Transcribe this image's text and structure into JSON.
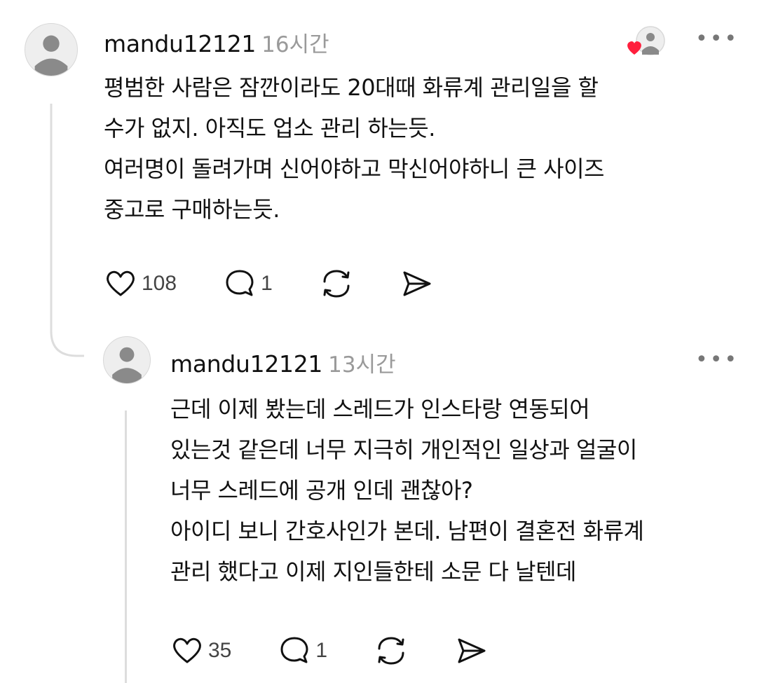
{
  "comments": [
    {
      "username": "mandu12121",
      "time": "16시간",
      "lines": [
        "평범한 사람은 잠깐이라도 20대때 화류계 관리일을 할",
        "수가 없지. 아직도 업소 관리 하는듯.",
        "여러명이 돌려가며 신어야하고 막신어야하니 큰 사이즈",
        "중고로 구매하는듯."
      ],
      "likes": "108",
      "replies": "1",
      "liked_by_author_icon": "heart-badge-avatar-icon",
      "more_label": "•••"
    },
    {
      "username": "mandu12121",
      "time": "13시간",
      "lines": [
        "근데 이제 봤는데 스레드가 인스타랑 연동되어",
        "있는것 같은데 너무 지극히 개인적인 일상과 얼굴이",
        "너무 스레드에 공개 인데 괜찮아?",
        "아이디 보니 간호사인가 본데. 남편이 결혼전 화류계",
        "관리 했다고 이제 지인들한테 소문 다 날텐데"
      ],
      "likes": "35",
      "replies": "1",
      "more_label": "•••"
    }
  ],
  "colors": {
    "text": "#111111",
    "muted": "#9a9a9a",
    "heart_badge": "#ff1f3d",
    "thread_line": "#dddddd"
  }
}
